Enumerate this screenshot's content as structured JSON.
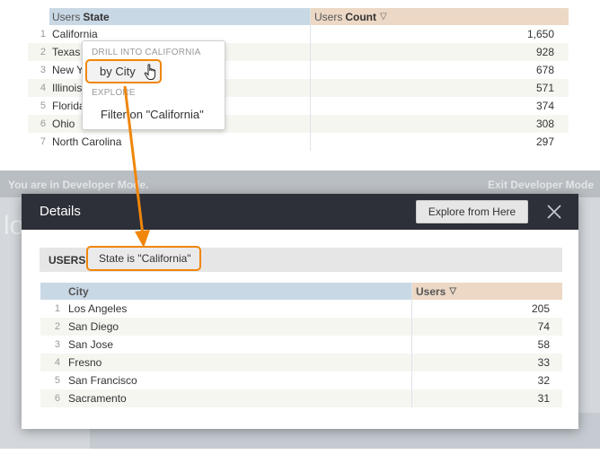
{
  "top_table": {
    "col1_prefix": "Users",
    "col1_field": "State",
    "col2_prefix": "Users",
    "col2_field": "Count",
    "rows": [
      {
        "num": "1",
        "state": "California",
        "count": "1,650"
      },
      {
        "num": "2",
        "state": "Texas",
        "count": "928"
      },
      {
        "num": "3",
        "state": "New Y",
        "count": "678"
      },
      {
        "num": "4",
        "state": "Illinois",
        "count": "571"
      },
      {
        "num": "5",
        "state": "Florida",
        "count": "374"
      },
      {
        "num": "6",
        "state": "Ohio",
        "count": "308"
      },
      {
        "num": "7",
        "state": "North Carolina",
        "count": "297"
      }
    ]
  },
  "drill_menu": {
    "section_drill": "DRILL INTO CALIFORNIA",
    "item_by_city": "by City",
    "section_explore": "EXPLORE",
    "item_filter": "Filter on \"California\""
  },
  "background": {
    "dev_mode_left": "You are in Developer Mode.",
    "dev_mode_right": "Exit Developer Mode",
    "ghost_letters": "lo"
  },
  "modal": {
    "title": "Details",
    "explore_button": "Explore from Here",
    "filter_label": "USERS",
    "filter_value": "State is \"California\"",
    "table": {
      "col1": "City",
      "col2": "Users",
      "rows": [
        {
          "num": "1",
          "city": "Los Angeles",
          "users": "205"
        },
        {
          "num": "2",
          "city": "San Diego",
          "users": "74"
        },
        {
          "num": "3",
          "city": "San Jose",
          "users": "58"
        },
        {
          "num": "4",
          "city": "Fresno",
          "users": "33"
        },
        {
          "num": "5",
          "city": "San Francisco",
          "users": "32"
        },
        {
          "num": "6",
          "city": "Sacramento",
          "users": "31"
        }
      ]
    }
  },
  "colors": {
    "highlight_orange": "#f0860a",
    "dimension_header": "#c9d8e5",
    "measure_header": "#ecd8c5",
    "modal_header": "#2d3038"
  }
}
